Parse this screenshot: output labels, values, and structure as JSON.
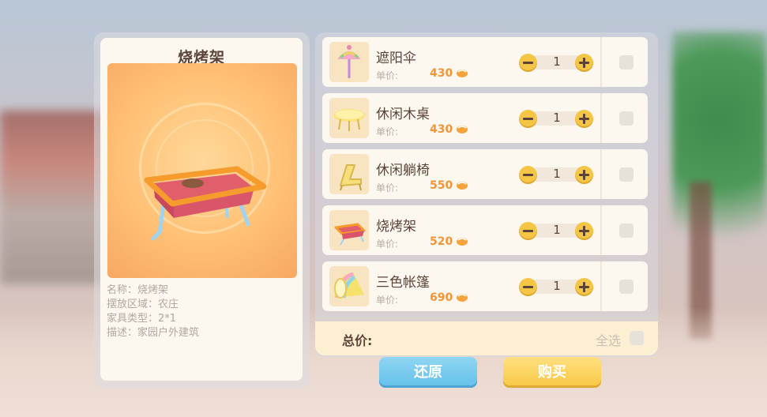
{
  "detail": {
    "title": "烧烤架",
    "lines": [
      "名称：烧烤架",
      "摆放区域：农庄",
      "家具类型：2*1",
      "描述：家园户外建筑"
    ]
  },
  "items": [
    {
      "name": "遮阳伞",
      "price_label": "单价:",
      "price": "430",
      "qty": "1",
      "icon": "parasol-icon"
    },
    {
      "name": "休闲木桌",
      "price_label": "单价:",
      "price": "430",
      "qty": "1",
      "icon": "table-icon"
    },
    {
      "name": "休闲躺椅",
      "price_label": "单价:",
      "price": "550",
      "qty": "1",
      "icon": "lounge-chair-icon"
    },
    {
      "name": "烧烤架",
      "price_label": "单价:",
      "price": "520",
      "qty": "1",
      "icon": "grill-icon"
    },
    {
      "name": "三色帐篷",
      "price_label": "单价:",
      "price": "690",
      "qty": "1",
      "icon": "tent-icon"
    }
  ],
  "total": {
    "label": "总价:",
    "select_all": "全选"
  },
  "buttons": {
    "reset": "还原",
    "buy": "购买"
  },
  "colors": {
    "price": "#f39438",
    "stepper": "#f5c646",
    "reset_button": "#63c0ea",
    "buy_button": "#f8c744",
    "title_text": "#5c4339"
  }
}
